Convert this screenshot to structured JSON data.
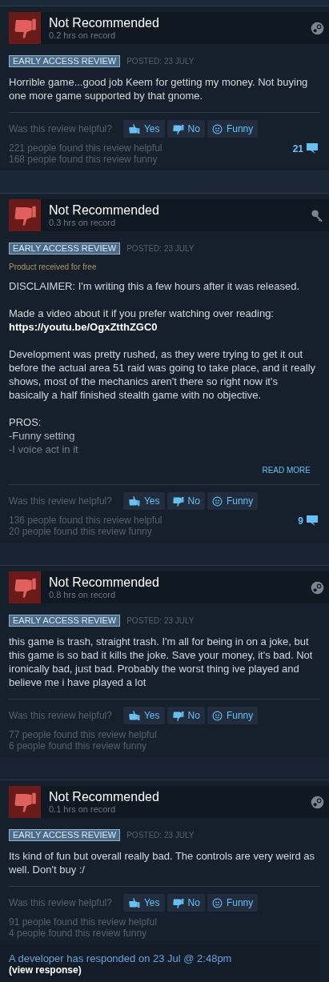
{
  "reviews": [
    {
      "verdict": "Not Recommended",
      "hours": "0.2 hrs on record",
      "source": {
        "kind": "steam"
      },
      "tag": "EARLY ACCESS REVIEW",
      "posted": "POSTED: 23 JULY",
      "body": [
        {
          "kind": "text",
          "text": "Horrible game...good job Keem for getting my money. Not buying one more game supported by that gnome."
        }
      ],
      "truncated": false,
      "helpful_prompt": "Was this review helpful?",
      "buttons": [
        "Yes",
        "No",
        "Funny"
      ],
      "helpful_count": "221 people found this review helpful",
      "funny_count": "168 people found this review funny",
      "comments": "21"
    },
    {
      "verdict": "Not Recommended",
      "hours": "0.3 hrs on record",
      "source": {
        "kind": "key"
      },
      "tag": "EARLY ACCESS REVIEW",
      "posted": "POSTED: 23 JULY",
      "received_free": "Product received for free",
      "body": [
        {
          "kind": "text",
          "text": "DISCLAIMER: I'm writing this a few hours after it was released."
        },
        {
          "kind": "text",
          "text": "Made a video about it if you prefer watching over reading:"
        },
        {
          "kind": "link",
          "text": "https://youtu.be/OgxZtthZGC0"
        },
        {
          "kind": "text",
          "text": "Development was pretty rushed, as they were trying to get it out before the actual area 51 raid was going to take place, and it really shows, most of the mechanics aren't there so right now it's basically a half finished stealth game with no objective."
        },
        {
          "kind": "text",
          "text": "PROS:\n-Funny setting\n-I voice act in it"
        }
      ],
      "truncated": true,
      "read_more": "READ MORE",
      "helpful_prompt": "Was this review helpful?",
      "buttons": [
        "Yes",
        "No",
        "Funny"
      ],
      "helpful_count": "136 people found this review helpful",
      "funny_count": "20 people found this review funny",
      "comments": "9"
    },
    {
      "verdict": "Not Recommended",
      "hours": "0.8 hrs on record",
      "source": {
        "kind": "steam"
      },
      "tag": "EARLY ACCESS REVIEW",
      "posted": "POSTED: 23 JULY",
      "body": [
        {
          "kind": "text",
          "text": "this game is trash, straight trash. I'm all for being in on a joke, but this game is so bad it kills the joke. Save your money, it's bad. Not ironically bad, just bad. Probably the worst thing ive played and believe me i have played a lot"
        }
      ],
      "truncated": false,
      "helpful_prompt": "Was this review helpful?",
      "buttons": [
        "Yes",
        "No",
        "Funny"
      ],
      "helpful_count": "77 people found this review helpful",
      "funny_count": "6 people found this review funny"
    },
    {
      "verdict": "Not Recommended",
      "hours": "0.1 hrs on record",
      "source": {
        "kind": "steam"
      },
      "tag": "EARLY ACCESS REVIEW",
      "posted": "POSTED: 23 JULY",
      "body": [
        {
          "kind": "text",
          "text": "Its kind of fun but overall really bad. The controls are very weird as well. Don't buy :/"
        }
      ],
      "truncated": false,
      "helpful_prompt": "Was this review helpful?",
      "buttons": [
        "Yes",
        "No",
        "Funny"
      ],
      "helpful_count": "91 people found this review helpful",
      "funny_count": "4 people found this review funny",
      "developer_response": {
        "text": "A developer has responded on 23 Jul @ 2:48pm",
        "link": "(view response)"
      }
    }
  ]
}
